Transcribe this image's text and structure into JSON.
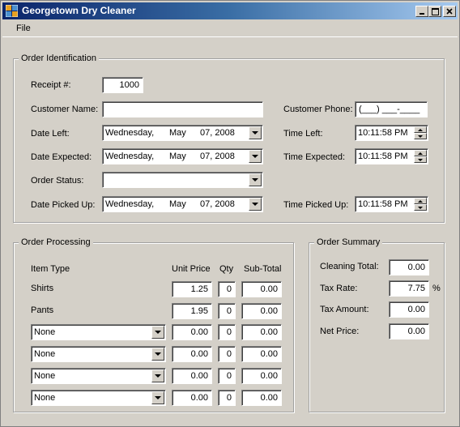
{
  "window": {
    "title": "Georgetown Dry Cleaner"
  },
  "menu": {
    "file_label": "File"
  },
  "order_identification": {
    "legend": "Order Identification",
    "receipt_label": "Receipt #:",
    "receipt_value": "1000",
    "customer_name_label": "Customer Name:",
    "customer_name_value": "",
    "customer_phone_label": "Customer Phone:",
    "customer_phone_value": "(___) ___-____",
    "date_left_label": "Date Left:",
    "date_left": {
      "dow": "Wednesday,",
      "month": "May",
      "day": "07, 2008"
    },
    "time_left_label": "Time Left:",
    "time_left": "10:11:58 PM",
    "date_expected_label": "Date Expected:",
    "date_expected": {
      "dow": "Wednesday,",
      "month": "May",
      "day": "07, 2008"
    },
    "time_expected_label": "Time Expected:",
    "time_expected": "10:11:58 PM",
    "order_status_label": "Order Status:",
    "order_status_value": "",
    "date_picked_label": "Date Picked Up:",
    "date_picked": {
      "dow": "Wednesday,",
      "month": "May",
      "day": "07, 2008"
    },
    "time_picked_label": "Time Picked Up:",
    "time_picked": "10:11:58 PM"
  },
  "order_processing": {
    "legend": "Order Processing",
    "headers": {
      "item_type": "Item Type",
      "unit_price": "Unit Price",
      "qty": "Qty",
      "subtotal": "Sub-Total"
    },
    "fixed_rows": [
      {
        "item": "Shirts",
        "unit_price": "1.25",
        "qty": "0",
        "subtotal": "0.00"
      },
      {
        "item": "Pants",
        "unit_price": "1.95",
        "qty": "0",
        "subtotal": "0.00"
      }
    ],
    "combo_rows": [
      {
        "item": "None",
        "unit_price": "0.00",
        "qty": "0",
        "subtotal": "0.00"
      },
      {
        "item": "None",
        "unit_price": "0.00",
        "qty": "0",
        "subtotal": "0.00"
      },
      {
        "item": "None",
        "unit_price": "0.00",
        "qty": "0",
        "subtotal": "0.00"
      },
      {
        "item": "None",
        "unit_price": "0.00",
        "qty": "0",
        "subtotal": "0.00"
      }
    ]
  },
  "order_summary": {
    "legend": "Order Summary",
    "cleaning_total_label": "Cleaning Total:",
    "cleaning_total": "0.00",
    "tax_rate_label": "Tax Rate:",
    "tax_rate": "7.75",
    "tax_rate_suffix": "%",
    "tax_amount_label": "Tax Amount:",
    "tax_amount": "0.00",
    "net_price_label": "Net Price:",
    "net_price": "0.00"
  }
}
